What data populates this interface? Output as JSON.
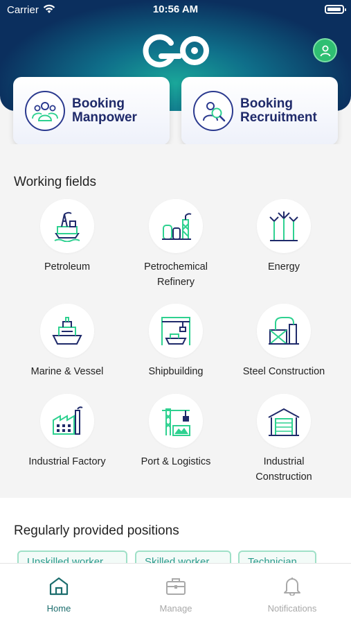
{
  "status_bar": {
    "carrier": "Carrier",
    "time": "10:56 AM"
  },
  "header": {
    "logo_text": "GO",
    "profile_icon": "user-icon"
  },
  "booking": [
    {
      "label": "Booking\nManpower",
      "line1": "Booking",
      "line2": "Manpower",
      "icon": "people-group-icon"
    },
    {
      "label": "Booking\nRecruitment",
      "line1": "Booking",
      "line2": "Recruitment",
      "icon": "recruitment-search-icon"
    }
  ],
  "working_fields": {
    "title": "Working fields",
    "items": [
      {
        "line1": "Petroleum",
        "line2": "",
        "icon": "oil-rig-icon"
      },
      {
        "line1": "Petrochemical",
        "line2": "Refinery",
        "icon": "refinery-icon"
      },
      {
        "line1": "Energy",
        "line2": "",
        "icon": "wind-turbine-icon"
      },
      {
        "line1": "Marine & Vessel",
        "line2": "",
        "icon": "ship-icon"
      },
      {
        "line1": "Shipbuilding",
        "line2": "",
        "icon": "shipyard-icon"
      },
      {
        "line1": "Steel Construction",
        "line2": "",
        "icon": "steel-structure-icon"
      },
      {
        "line1": "Industrial Factory",
        "line2": "",
        "icon": "factory-icon"
      },
      {
        "line1": "Port & Logistics",
        "line2": "",
        "icon": "port-crane-icon"
      },
      {
        "line1": "Industrial",
        "line2": "Construction",
        "icon": "warehouse-icon"
      }
    ]
  },
  "positions": {
    "title": "Regularly provided positions",
    "chips": [
      "Unskilled worker",
      "Skilled worker",
      "Technician"
    ]
  },
  "tabs": [
    {
      "label": "Home",
      "icon": "home-icon",
      "active": true
    },
    {
      "label": "Manage",
      "icon": "briefcase-icon",
      "active": false
    },
    {
      "label": "Notifications",
      "icon": "bell-icon",
      "active": false
    }
  ],
  "colors": {
    "header_dark": "#0b2f5e",
    "header_glow": "#1aa79a",
    "brand_navy": "#1f2a6a",
    "icon_green": "#2ed190",
    "icon_navy": "#1f2a6a",
    "tab_active": "#1c6d6d",
    "tab_inactive": "#a9a9a9",
    "profile_green": "#2fbf72"
  }
}
